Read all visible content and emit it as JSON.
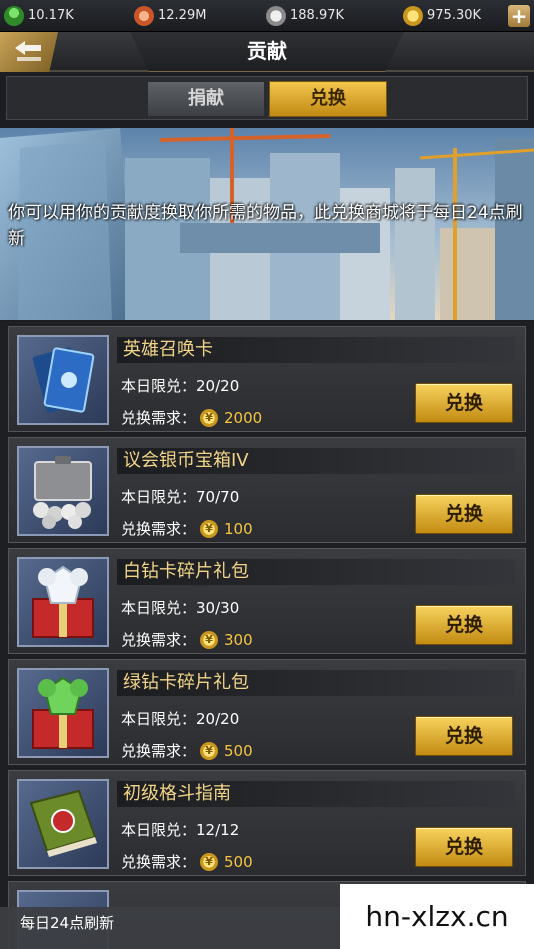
{
  "resources": [
    {
      "icon": "person-icon",
      "value": "10.17K"
    },
    {
      "icon": "medal-icon",
      "value": "12.29M"
    },
    {
      "icon": "silver-coin-icon",
      "value": "188.97K"
    },
    {
      "icon": "gold-coin-icon",
      "value": "975.30K"
    }
  ],
  "header": {
    "title": "贡献"
  },
  "tabs": [
    {
      "label": "捐献",
      "active": false
    },
    {
      "label": "兑换",
      "active": true
    }
  ],
  "banner": {
    "description": "你可以用你的贡献度换取你所需的物品，此兑换商城将于每日24点刷新"
  },
  "items": [
    {
      "name": "英雄召唤卡",
      "limit_label": "本日限兑：",
      "limit": "20/20",
      "req_label": "兑换需求：",
      "cost": "2000",
      "button": "兑换"
    },
    {
      "name": "议会银币宝箱IV",
      "limit_label": "本日限兑：",
      "limit": "70/70",
      "req_label": "兑换需求：",
      "cost": "100",
      "button": "兑换"
    },
    {
      "name": "白钻卡碎片礼包",
      "limit_label": "本日限兑：",
      "limit": "30/30",
      "req_label": "兑换需求：",
      "cost": "300",
      "button": "兑换"
    },
    {
      "name": "绿钻卡碎片礼包",
      "limit_label": "本日限兑：",
      "limit": "20/20",
      "req_label": "兑换需求：",
      "cost": "500",
      "button": "兑换"
    },
    {
      "name": "初级格斗指南",
      "limit_label": "本日限兑：",
      "limit": "12/12",
      "req_label": "兑换需求：",
      "cost": "500",
      "button": "兑换"
    }
  ],
  "footer": {
    "text": "每日24点刷新"
  },
  "watermark": "hn-xlzx.cn",
  "colors": {
    "accent_gold": "#f5c542",
    "item_name": "#f0d488"
  }
}
